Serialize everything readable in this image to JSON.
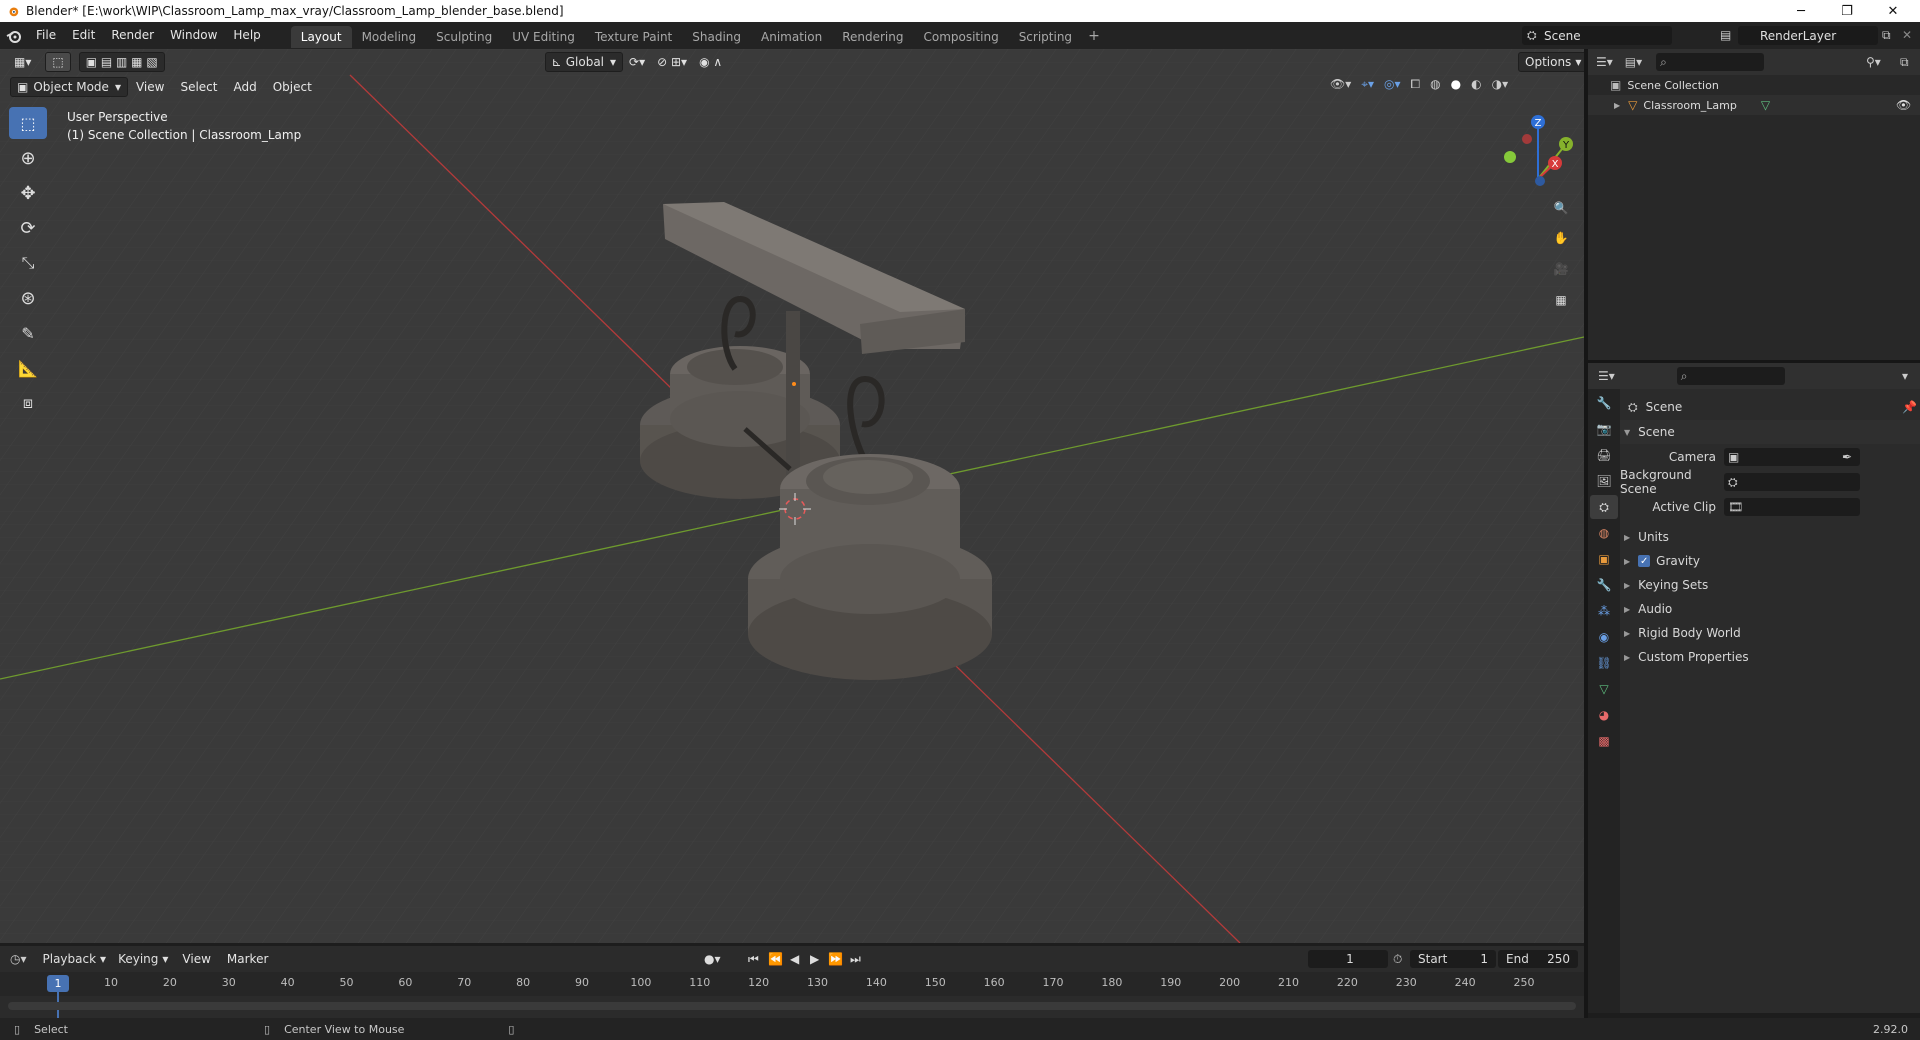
{
  "window": {
    "title": "Blender* [E:\\work\\WIP\\Classroom_Lamp_max_vray/Classroom_Lamp_blender_base.blend]",
    "minimize": "─",
    "maximize": "❐",
    "close": "✕"
  },
  "menu": [
    "File",
    "Edit",
    "Render",
    "Window",
    "Help"
  ],
  "workspaces": [
    "Layout",
    "Modeling",
    "Sculpting",
    "UV Editing",
    "Texture Paint",
    "Shading",
    "Animation",
    "Rendering",
    "Compositing",
    "Scripting"
  ],
  "active_workspace": "Layout",
  "scene_name": "Scene",
  "view_layer": "RenderLayer",
  "viewport": {
    "transform_orientation": "Global",
    "options_label": "Options",
    "mode": "Object Mode",
    "menus": [
      "View",
      "Select",
      "Add",
      "Object"
    ],
    "perspective_label": "User Perspective",
    "collection_label": "(1) Scene Collection | Classroom_Lamp",
    "gizmo_axes": {
      "x": "X",
      "y": "Y",
      "z": "Z"
    }
  },
  "outliner": {
    "root": "Scene Collection",
    "items": [
      {
        "name": "Classroom_Lamp"
      }
    ]
  },
  "properties": {
    "context": "Scene",
    "panel_title": "Scene",
    "fields": [
      {
        "label": "Camera",
        "value": ""
      },
      {
        "label": "Background Scene",
        "value": ""
      },
      {
        "label": "Active Clip",
        "value": ""
      }
    ],
    "subpanels": [
      {
        "label": "Units",
        "checkbox": false
      },
      {
        "label": "Gravity",
        "checkbox": true
      },
      {
        "label": "Keying Sets",
        "checkbox": false
      },
      {
        "label": "Audio",
        "checkbox": false
      },
      {
        "label": "Rigid Body World",
        "checkbox": false
      },
      {
        "label": "Custom Properties",
        "checkbox": false
      }
    ]
  },
  "timeline": {
    "menus": [
      "Playback",
      "Keying",
      "View",
      "Marker"
    ],
    "current_frame": "1",
    "start_label": "Start",
    "start": "1",
    "end_label": "End",
    "end": "250",
    "ruler_ticks": [
      "1",
      "10",
      "20",
      "30",
      "40",
      "50",
      "60",
      "70",
      "80",
      "90",
      "100",
      "110",
      "120",
      "130",
      "140",
      "150",
      "160",
      "170",
      "180",
      "190",
      "200",
      "210",
      "220",
      "230",
      "240",
      "250"
    ]
  },
  "statusbar": {
    "left_action": "Select",
    "middle_action": "Center View to Mouse",
    "version": "2.92.0"
  },
  "colors": {
    "accent": "#4772b3",
    "x_axis": "#b33a3a",
    "y_axis": "#6e9a2e",
    "viewport_bg": "#3a3a3a"
  }
}
